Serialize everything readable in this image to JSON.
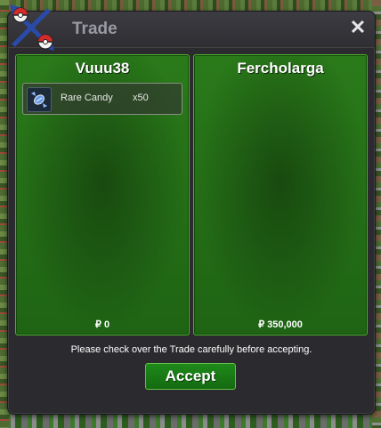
{
  "window": {
    "title": "Trade",
    "close_label": "✕"
  },
  "left_panel": {
    "player_name": "Vuuu38",
    "items": [
      {
        "name": "Rare Candy",
        "quantity": "x50",
        "icon": "rare-candy-icon"
      }
    ],
    "money": "₽ 0"
  },
  "right_panel": {
    "player_name": "Fercholarga",
    "items": [],
    "money": "₽ 350,000"
  },
  "footer": {
    "message": "Please check over the Trade carefully before accepting.",
    "accept_label": "Accept"
  },
  "colors": {
    "panel_green": "#2a7a1a",
    "accept_green": "#1e8a1a",
    "window_bg": "#2b2b2f"
  }
}
